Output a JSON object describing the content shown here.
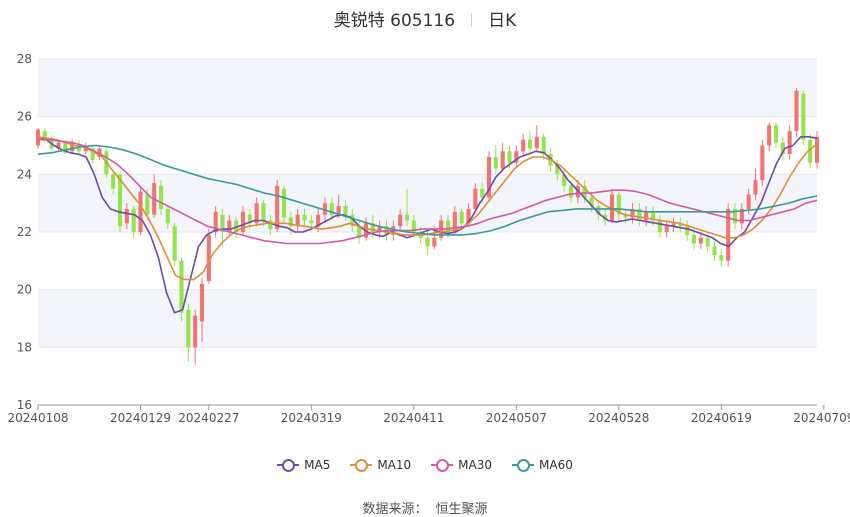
{
  "header": {
    "name": "奥锐特 605116",
    "period": "日K"
  },
  "source": {
    "label": "数据来源：",
    "provider": "恒生聚源"
  },
  "colors": {
    "up": "#f07474",
    "down": "#94e44d",
    "grid": "#e6e9f0",
    "band": "#f3f5fb",
    "axis": "#555555"
  },
  "chart_data": {
    "type": "candlestick",
    "y_axis": {
      "min": 16,
      "max": 28,
      "ticks": [
        16,
        18,
        20,
        22,
        24,
        26,
        28
      ]
    },
    "x_ticks": [
      {
        "index": 0,
        "label": "20240108"
      },
      {
        "index": 15,
        "label": "20240129"
      },
      {
        "index": 25,
        "label": "20240227"
      },
      {
        "index": 40,
        "label": "20240319"
      },
      {
        "index": 55,
        "label": "20240411"
      },
      {
        "index": 70,
        "label": "20240507"
      },
      {
        "index": 85,
        "label": "20240528"
      },
      {
        "index": 100,
        "label": "20240619"
      },
      {
        "index": 115,
        "label": "20240709"
      }
    ],
    "candles": [
      [
        25.0,
        25.55,
        25.6,
        24.9
      ],
      [
        25.5,
        25.2,
        25.6,
        25.1
      ],
      [
        25.2,
        24.9,
        25.35,
        24.8
      ],
      [
        24.9,
        25.1,
        25.2,
        24.8
      ],
      [
        25.1,
        24.75,
        25.2,
        24.7
      ],
      [
        24.8,
        25.1,
        25.2,
        24.7
      ],
      [
        25.0,
        24.8,
        25.2,
        24.7
      ],
      [
        24.8,
        25.0,
        25.1,
        24.7
      ],
      [
        24.9,
        24.5,
        25.0,
        24.4
      ],
      [
        24.6,
        24.9,
        25.0,
        24.5
      ],
      [
        24.8,
        24.0,
        24.9,
        23.9
      ],
      [
        24.0,
        23.5,
        24.1,
        23.3
      ],
      [
        24.0,
        22.2,
        24.1,
        22.0
      ],
      [
        22.3,
        22.8,
        23.0,
        22.1
      ],
      [
        22.8,
        22.0,
        22.9,
        21.8
      ],
      [
        22.0,
        23.4,
        23.6,
        21.9
      ],
      [
        23.3,
        22.6,
        23.5,
        22.4
      ],
      [
        22.6,
        23.7,
        24.0,
        22.5
      ],
      [
        23.6,
        22.8,
        23.8,
        22.6
      ],
      [
        22.8,
        22.3,
        22.9,
        22.1
      ],
      [
        22.2,
        21.0,
        22.3,
        20.8
      ],
      [
        21.0,
        19.2,
        21.1,
        18.9
      ],
      [
        19.3,
        18.0,
        19.5,
        17.5
      ],
      [
        18.0,
        19.1,
        19.3,
        17.4
      ],
      [
        18.9,
        20.2,
        20.4,
        18.2
      ],
      [
        20.3,
        21.9,
        22.1,
        20.2
      ],
      [
        22.0,
        22.7,
        22.9,
        21.8
      ],
      [
        22.6,
        22.0,
        22.8,
        21.5
      ],
      [
        22.0,
        22.4,
        22.6,
        21.9
      ],
      [
        22.4,
        22.0,
        22.5,
        21.8
      ],
      [
        22.0,
        22.7,
        22.9,
        21.9
      ],
      [
        22.6,
        22.3,
        22.8,
        22.1
      ],
      [
        22.3,
        23.0,
        23.2,
        22.2
      ],
      [
        23.0,
        22.4,
        23.1,
        22.2
      ],
      [
        22.4,
        22.1,
        22.6,
        21.9
      ],
      [
        22.1,
        23.6,
        23.8,
        22.0
      ],
      [
        23.5,
        22.5,
        23.6,
        22.3
      ],
      [
        22.5,
        22.2,
        22.7,
        21.9
      ],
      [
        22.2,
        22.6,
        22.8,
        22.0
      ],
      [
        22.6,
        22.4,
        22.8,
        22.2
      ],
      [
        22.4,
        22.3,
        22.6,
        22.1
      ],
      [
        22.2,
        22.6,
        22.8,
        22.0
      ],
      [
        22.6,
        23.0,
        23.2,
        22.4
      ],
      [
        23.0,
        22.6,
        23.2,
        22.4
      ],
      [
        22.6,
        22.9,
        23.3,
        22.5
      ],
      [
        22.9,
        22.6,
        23.1,
        22.4
      ],
      [
        22.6,
        22.2,
        22.8,
        22.0
      ],
      [
        22.2,
        21.8,
        22.4,
        21.6
      ],
      [
        21.8,
        22.3,
        22.5,
        21.7
      ],
      [
        22.3,
        22.0,
        22.6,
        21.8
      ],
      [
        22.0,
        22.2,
        22.4,
        21.8
      ],
      [
        22.2,
        21.9,
        22.4,
        21.7
      ],
      [
        21.9,
        22.2,
        22.4,
        21.7
      ],
      [
        22.2,
        22.6,
        22.8,
        22.0
      ],
      [
        22.6,
        22.4,
        23.5,
        22.2
      ],
      [
        22.4,
        22.0,
        22.6,
        21.8
      ],
      [
        22.0,
        21.8,
        22.2,
        21.6
      ],
      [
        21.8,
        21.5,
        22.0,
        21.2
      ],
      [
        21.5,
        21.8,
        22.2,
        21.4
      ],
      [
        21.8,
        22.4,
        22.6,
        21.7
      ],
      [
        22.4,
        22.0,
        22.6,
        21.8
      ],
      [
        22.0,
        22.7,
        22.9,
        21.9
      ],
      [
        22.7,
        22.3,
        22.8,
        22.1
      ],
      [
        22.3,
        22.8,
        23.0,
        22.2
      ],
      [
        22.8,
        23.5,
        23.7,
        22.7
      ],
      [
        23.5,
        23.2,
        23.7,
        23.0
      ],
      [
        23.2,
        24.6,
        24.8,
        23.1
      ],
      [
        24.6,
        24.2,
        25.0,
        24.0
      ],
      [
        24.2,
        24.8,
        25.1,
        24.1
      ],
      [
        24.8,
        24.4,
        25.0,
        24.2
      ],
      [
        24.4,
        24.8,
        25.0,
        24.2
      ],
      [
        24.8,
        25.2,
        25.4,
        24.6
      ],
      [
        25.2,
        24.9,
        25.5,
        24.7
      ],
      [
        24.9,
        25.3,
        25.7,
        24.8
      ],
      [
        25.3,
        24.7,
        25.4,
        24.5
      ],
      [
        24.7,
        24.3,
        24.9,
        24.1
      ],
      [
        24.3,
        24.0,
        24.5,
        23.8
      ],
      [
        24.0,
        23.6,
        24.2,
        23.4
      ],
      [
        23.6,
        23.2,
        23.8,
        23.0
      ],
      [
        23.2,
        23.6,
        23.8,
        23.0
      ],
      [
        23.6,
        23.2,
        23.8,
        23.0
      ],
      [
        23.2,
        22.9,
        23.4,
        22.7
      ],
      [
        22.9,
        22.6,
        23.1,
        22.4
      ],
      [
        22.6,
        22.4,
        22.8,
        22.2
      ],
      [
        22.4,
        23.3,
        23.5,
        22.3
      ],
      [
        23.3,
        22.6,
        23.4,
        22.4
      ],
      [
        22.6,
        22.5,
        22.8,
        22.3
      ],
      [
        22.5,
        22.8,
        23.0,
        22.3
      ],
      [
        22.8,
        22.4,
        23.0,
        22.2
      ],
      [
        22.4,
        22.7,
        22.9,
        22.2
      ],
      [
        22.7,
        22.4,
        22.9,
        22.2
      ],
      [
        22.4,
        22.0,
        22.6,
        21.8
      ],
      [
        22.0,
        22.2,
        22.4,
        21.8
      ],
      [
        22.2,
        22.3,
        22.5,
        22.0
      ],
      [
        22.3,
        22.2,
        22.5,
        22.0
      ],
      [
        22.2,
        21.9,
        22.4,
        21.7
      ],
      [
        21.9,
        21.6,
        22.1,
        21.4
      ],
      [
        21.6,
        21.8,
        22.0,
        21.4
      ],
      [
        21.8,
        21.5,
        22.0,
        21.3
      ],
      [
        21.5,
        21.2,
        21.7,
        21.0
      ],
      [
        21.2,
        21.0,
        21.4,
        20.8
      ],
      [
        21.0,
        22.8,
        23.0,
        20.8
      ],
      [
        22.8,
        22.3,
        23.0,
        22.1
      ],
      [
        22.3,
        22.8,
        23.0,
        22.1
      ],
      [
        22.8,
        23.3,
        23.5,
        22.6
      ],
      [
        23.3,
        23.8,
        24.2,
        23.1
      ],
      [
        23.8,
        25.0,
        25.2,
        23.6
      ],
      [
        25.0,
        25.7,
        25.8,
        24.8
      ],
      [
        25.7,
        25.1,
        25.8,
        24.9
      ],
      [
        25.1,
        24.7,
        25.3,
        24.5
      ],
      [
        24.7,
        25.5,
        25.7,
        24.5
      ],
      [
        25.5,
        26.9,
        27.0,
        25.3
      ],
      [
        26.8,
        25.2,
        26.9,
        25.0
      ],
      [
        25.2,
        24.4,
        25.4,
        24.2
      ],
      [
        24.4,
        25.3,
        25.5,
        24.2
      ]
    ],
    "moving_averages": [
      {
        "name": "MA5",
        "color": "#6d4ba6",
        "values": [
          25.3,
          25.2,
          25.0,
          24.85,
          24.75,
          24.7,
          24.6,
          24.0,
          23.2,
          22.8,
          22.7,
          22.65,
          22.6,
          22.4,
          21.9,
          21.1,
          19.9,
          19.2,
          19.3,
          20.4,
          21.5,
          21.9,
          22.05,
          22.1,
          22.1,
          22.2,
          22.3,
          22.4,
          22.4,
          22.3,
          22.2,
          22.15,
          22.0,
          22.0,
          22.1,
          22.25,
          22.4,
          22.55,
          22.6,
          22.5,
          22.2,
          22.0,
          21.9,
          21.85,
          22.0,
          21.9,
          21.8,
          21.9,
          22.0,
          22.1,
          22.0,
          21.95,
          22.0,
          22.15,
          22.5,
          23.0,
          23.4,
          23.9,
          24.2,
          24.4,
          24.6,
          24.7,
          24.8,
          24.75,
          24.5,
          24.2,
          23.8,
          23.5,
          23.2,
          22.9,
          22.6,
          22.4,
          22.35,
          22.4,
          22.45,
          22.4,
          22.35,
          22.3,
          22.25,
          22.2,
          22.15,
          22.1,
          22.0,
          21.9,
          21.8,
          21.6,
          21.5,
          21.8,
          22.0,
          22.5,
          23.0,
          23.7,
          24.4,
          24.9,
          25.0,
          25.3,
          25.3,
          25.25
        ]
      },
      {
        "name": "MA10",
        "color": "#e08e3b",
        "values": [
          25.3,
          25.25,
          25.2,
          25.1,
          25.0,
          24.95,
          24.8,
          24.6,
          24.2,
          23.8,
          23.4,
          23.0,
          22.5,
          21.9,
          21.2,
          20.5,
          20.35,
          20.35,
          20.6,
          21.2,
          21.6,
          21.9,
          22.1,
          22.2,
          22.25,
          22.3,
          22.3,
          22.3,
          22.25,
          22.2,
          22.15,
          22.1,
          22.15,
          22.2,
          22.3,
          22.2,
          22.1,
          22.05,
          22.0,
          21.95,
          21.9,
          21.9,
          21.9,
          21.95,
          22.0,
          22.05,
          22.1,
          22.3,
          22.6,
          23.0,
          23.4,
          23.8,
          24.2,
          24.45,
          24.6,
          24.6,
          24.5,
          24.3,
          24.0,
          23.7,
          23.4,
          23.1,
          22.9,
          22.75,
          22.6,
          22.55,
          22.5,
          22.45,
          22.4,
          22.35,
          22.3,
          22.2,
          22.1,
          22.0,
          21.9,
          21.8,
          21.8,
          21.9,
          22.1,
          22.4,
          22.8,
          23.3,
          23.9,
          24.4,
          24.8,
          25.05
        ]
      },
      {
        "name": "MA30",
        "color": "#d35aa5",
        "values": [
          25.2,
          25.2,
          25.15,
          25.1,
          25.0,
          24.8,
          24.6,
          24.35,
          24.0,
          23.6,
          23.2,
          23.0,
          22.8,
          22.6,
          22.4,
          22.2,
          22.1,
          22.0,
          21.9,
          21.8,
          21.7,
          21.65,
          21.6,
          21.6,
          21.6,
          21.6,
          21.65,
          21.7,
          21.8,
          21.9,
          22.0,
          22.05,
          22.05,
          22.05,
          22.1,
          22.1,
          22.1,
          22.15,
          22.2,
          22.3,
          22.45,
          22.55,
          22.65,
          22.8,
          22.95,
          23.1,
          23.2,
          23.3,
          23.35,
          23.35,
          23.4,
          23.45,
          23.45,
          23.4,
          23.3,
          23.15,
          23.0,
          22.9,
          22.8,
          22.7,
          22.6,
          22.5,
          22.4,
          22.4,
          22.5,
          22.6,
          22.7,
          22.8,
          23.0,
          23.1
        ]
      },
      {
        "name": "MA60",
        "color": "#3c9a9a",
        "values": [
          24.7,
          24.75,
          24.85,
          24.95,
          25.0,
          24.95,
          24.85,
          24.7,
          24.5,
          24.3,
          24.15,
          24.0,
          23.85,
          23.75,
          23.65,
          23.5,
          23.35,
          23.25,
          23.1,
          22.95,
          22.8,
          22.65,
          22.5,
          22.35,
          22.2,
          22.1,
          22.0,
          21.95,
          21.9,
          21.9,
          21.9,
          21.95,
          22.05,
          22.2,
          22.4,
          22.55,
          22.7,
          22.75,
          22.8,
          22.8,
          22.8,
          22.8,
          22.75,
          22.7,
          22.7,
          22.7,
          22.7,
          22.7,
          22.7,
          22.7,
          22.75,
          22.8,
          22.9,
          23.0,
          23.15,
          23.25
        ]
      }
    ]
  },
  "legend": [
    {
      "label": "MA5",
      "color": "#6d4ba6"
    },
    {
      "label": "MA10",
      "color": "#e08e3b"
    },
    {
      "label": "MA30",
      "color": "#d35aa5"
    },
    {
      "label": "MA60",
      "color": "#3c9a9a"
    }
  ]
}
